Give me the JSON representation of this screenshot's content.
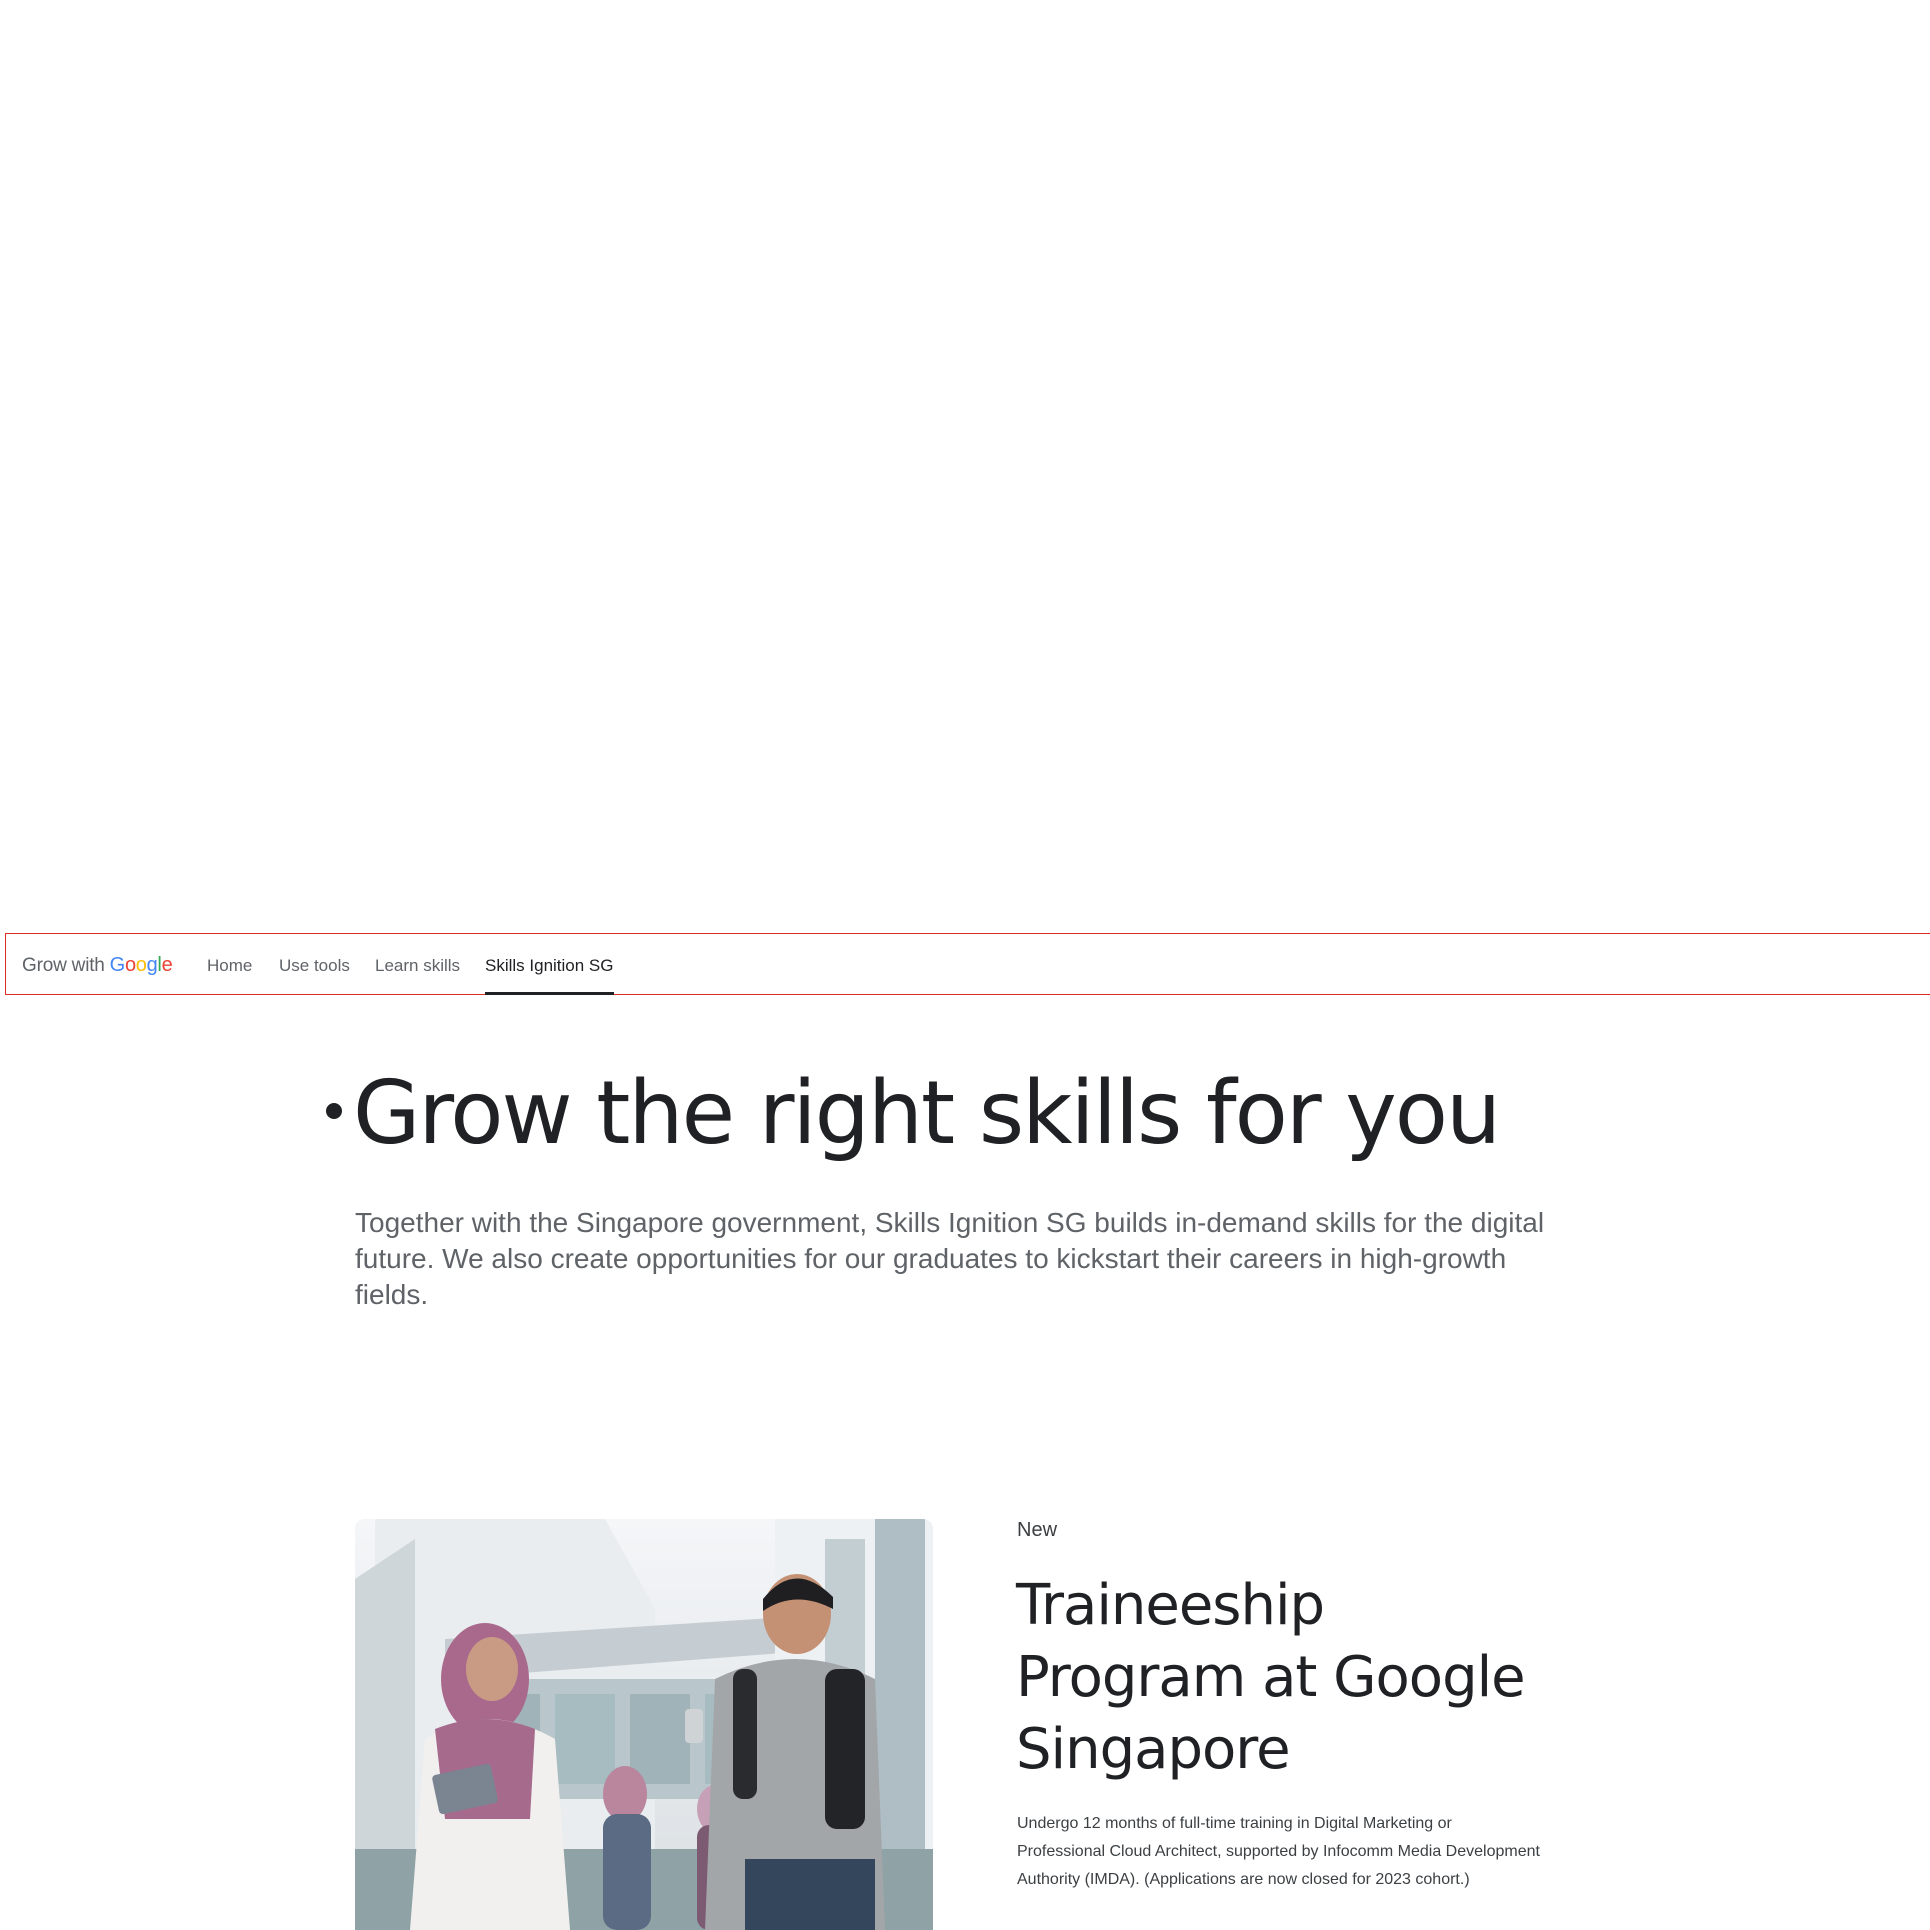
{
  "header": {
    "brand": {
      "prefix": "Grow with",
      "google_letters": [
        "G",
        "o",
        "o",
        "g",
        "l",
        "e"
      ]
    },
    "nav": [
      {
        "label": "Home",
        "active": false
      },
      {
        "label": "Use tools",
        "active": false
      },
      {
        "label": "Learn skills",
        "active": false
      },
      {
        "label": "Skills Ignition SG",
        "active": true
      }
    ]
  },
  "hero": {
    "title": "Grow the right skills for you",
    "description": "Together with the Singapore government, Skills Ignition SG builds in-demand skills for the digital future. We also create opportunities for our graduates to kickstart their careers in high-growth fields."
  },
  "feature": {
    "eyebrow": "New",
    "title": "Traineeship Program at Google Singapore",
    "description": "Undergo 12 months of full-time training in Digital Marketing or Professional Cloud Architect, supported by Infocomm Media Development Authority (IMDA). (Applications are now closed for 2023 cohort.)",
    "image": "photo of students walking outside a building"
  },
  "colors": {
    "header_border": "#d93025",
    "text_primary": "#202124",
    "text_secondary": "#5f6368",
    "google_blue": "#4285f4",
    "google_red": "#ea4335",
    "google_yellow": "#fbbc05",
    "google_green": "#34a853"
  }
}
